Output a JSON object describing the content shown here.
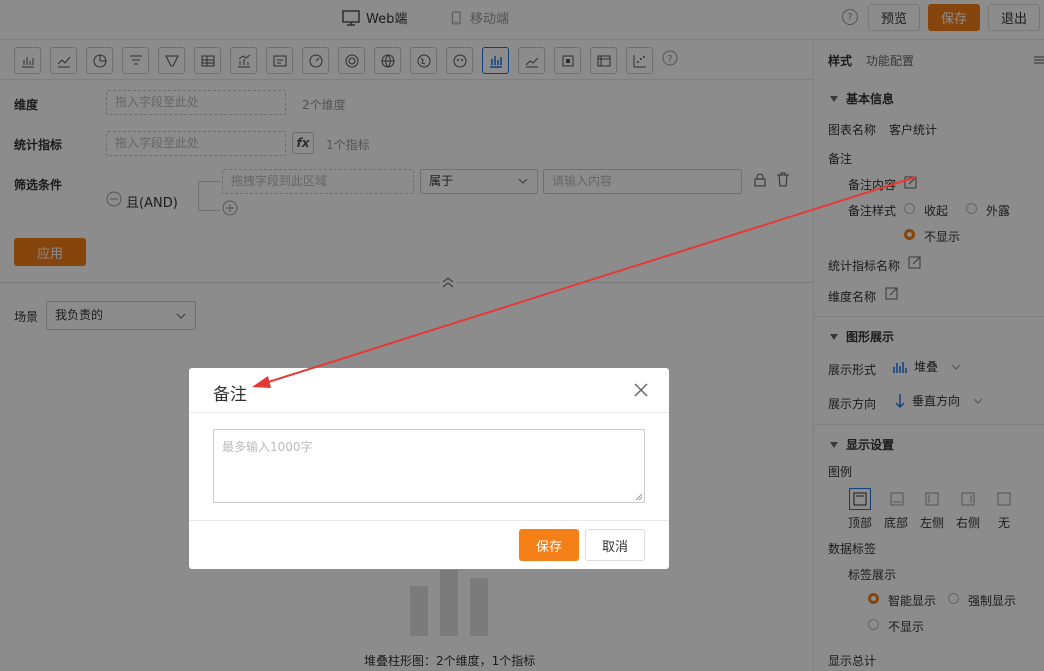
{
  "topbar": {
    "web_label": "Web端",
    "mobile_label": "移动端",
    "help_glyph": "?",
    "preview_label": "预览",
    "save_label": "保存",
    "exit_label": "退出"
  },
  "config": {
    "dimension_label": "维度",
    "dimension_placeholder": "拖入字段至此处",
    "dimension_count": "2个维度",
    "metric_label": "统计指标",
    "metric_placeholder": "拖入字段至此处",
    "metric_fx": "fx",
    "metric_count": "1个指标",
    "filter_label": "筛选条件",
    "filter_logic": "且(AND)",
    "filter_drop": "拖拽字段到此区域",
    "filter_operator": "属于",
    "filter_value_placeholder": "请输入内容",
    "apply_label": "应用",
    "scene_label": "场景",
    "scene_value": "我负责的"
  },
  "chart": {
    "caption": "堆叠柱形图：2个维度，1个指标"
  },
  "panel": {
    "tab_style": "样式",
    "tab_function": "功能配置",
    "basic_info_title": "基本信息",
    "chart_name_label": "图表名称",
    "chart_name_value": "客户统计",
    "note_label": "备注",
    "note_content_label": "备注内容",
    "note_style_label": "备注样式",
    "note_style_collapse": "收起",
    "note_style_expose": "外露",
    "note_style_hide": "不显示",
    "metric_name_label": "统计指标名称",
    "dimension_name_label": "维度名称",
    "graphic_title": "图形展示",
    "display_form_label": "展示形式",
    "display_form_value": "堆叠",
    "display_direction_label": "展示方向",
    "display_direction_value": "垂直方向",
    "display_settings_title": "显示设置",
    "legend_label": "图例",
    "legend_options": [
      "顶部",
      "底部",
      "左侧",
      "右侧",
      "无"
    ],
    "data_label_title": "数据标签",
    "label_display_label": "标签展示",
    "label_smart": "智能显示",
    "label_force": "强制显示",
    "label_hide": "不显示",
    "show_total_label": "显示总计"
  },
  "modal": {
    "title": "备注",
    "textarea_placeholder": "最多输入1000字",
    "save_label": "保存",
    "cancel_label": "取消"
  },
  "colors": {
    "accent": "#f57f17",
    "active_blue": "#1a73e8",
    "annotation_arrow": "#e53935"
  }
}
